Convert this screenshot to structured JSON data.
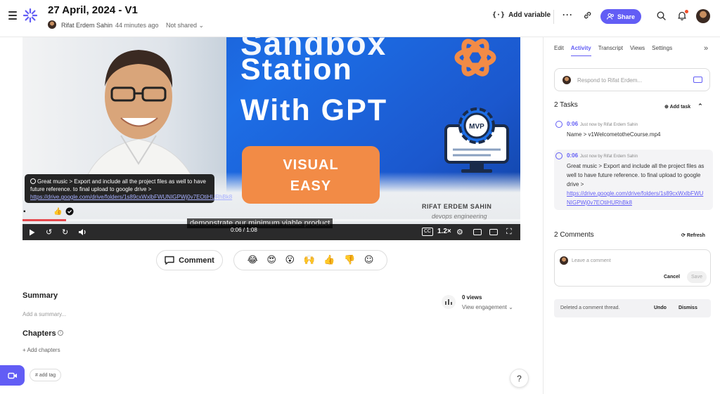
{
  "header": {
    "title": "27 April, 2024 - V1",
    "author": "Rifat Erdem Sahin",
    "time_ago": "44 minutes ago",
    "sharing": "Not shared",
    "add_variable_label": "Add variable",
    "share_label": "Share",
    "brand_color": "#625df5"
  },
  "video": {
    "title_line1": "Sandbox",
    "title_line2": "Station",
    "title_line3": "With GPT",
    "badge_line1": "VISUAL",
    "badge_line2": "EASY",
    "mvp_label": "MVP",
    "signature_name": "RIFAT ERDEM SAHIN",
    "signature_sub": "devops engineering",
    "subtitle": "demonstrate our minimum viable product",
    "current_time": "0:06",
    "duration": "1:08",
    "time_display": "0:06 / 1:08",
    "progress_fraction": 0.088,
    "speed": "1.2×",
    "cc_label": "CC",
    "popup_text": "Great music > Export and include all the project files as well to have future reference. to final upload to google drive >",
    "popup_link": "https://drive.google.com/drive/folders/1s89cxWxlbFWUNIGPWj0v7EOtiHURhBk8",
    "progress_color": "#e5484d"
  },
  "actions": {
    "comment_label": "Comment",
    "reactions": [
      "😂",
      "😍",
      "😮",
      "🙌",
      "👍",
      "👎"
    ]
  },
  "summary": {
    "title": "Summary",
    "placeholder": "Add a summary...",
    "views": "0 views",
    "engagement_label": "View engagement"
  },
  "chapters": {
    "title": "Chapters",
    "add_label": "+ Add chapters"
  },
  "tag": {
    "label": "# add tag"
  },
  "help_label": "?",
  "sidebar": {
    "tabs": [
      "Edit",
      "Activity",
      "Transcript",
      "Views",
      "Settings"
    ],
    "active_tab": "Activity",
    "respond_placeholder": "Respond to Rifat Erdem...",
    "tasks_title": "2 Tasks",
    "add_task_label": "Add task",
    "tasks": [
      {
        "time": "0:06",
        "who": "Just now by Rifat Erdem Sahin",
        "text": "Name > v1WelcometotheCourse.mp4",
        "link": ""
      },
      {
        "time": "0:06",
        "who": "Just now by Rifat Erdem Sahin",
        "text": "Great music > Export and include all the project files as well to have future reference. to final upload to google drive >",
        "link": "https://drive.google.com/drive/folders/1s89cxWxlbFWUNIGPWj0v7EOtiHURhBk8"
      }
    ],
    "comments_title": "2 Comments",
    "refresh_label": "Refresh",
    "comment_placeholder": "Leave a comment",
    "cancel_label": "Cancel",
    "save_label": "Save",
    "deleted_text": "Deleted a comment thread.",
    "undo_label": "Undo",
    "dismiss_label": "Dismiss"
  }
}
